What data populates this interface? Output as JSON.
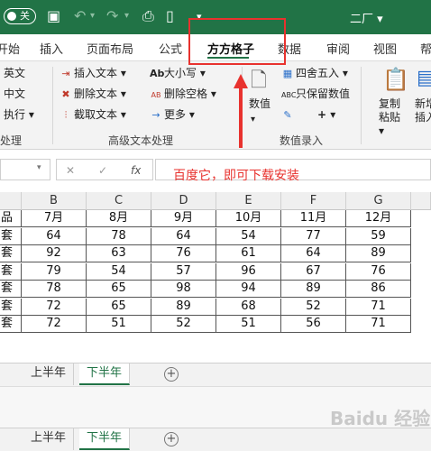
{
  "titlebar": {
    "autosave_label": "关",
    "doc_title": "二厂 ▾",
    "accent": "#217346"
  },
  "tabs": [
    "开始",
    "插入",
    "页面布局",
    "公式",
    "方方格子",
    "数据",
    "审阅",
    "视图",
    "帮"
  ],
  "active_tab": "方方格子",
  "ribbon": {
    "col1": [
      "英文",
      "中文",
      "执行 ▾"
    ],
    "group1_label": "处理",
    "col2": [
      "插入文本 ▾",
      "删除文本 ▾",
      "截取文本 ▾"
    ],
    "col3": [
      "大小写 ▾",
      "删除空格 ▾",
      "更多 ▾"
    ],
    "col3_icons": [
      "Ab",
      "AB",
      "→"
    ],
    "group2_label": "高级文本处理",
    "numeric_label": "数值",
    "round_label": "四舍五入 ▾",
    "keep_numeric_label": "只保留数值",
    "plus_label": "+ ▾",
    "group3_label": "数值录入",
    "copy_paste_label": "复制粘贴 ▾",
    "new_label": "新增插入"
  },
  "formula_bar": {
    "cancel": "✕",
    "enter": "✓",
    "fx": "fx"
  },
  "annotation": {
    "text": "百度它，即可下载安装",
    "color": "#e8322e"
  },
  "grid": {
    "columns": [
      "B",
      "C",
      "D",
      "E",
      "F",
      "G"
    ],
    "months": [
      "7月",
      "8月",
      "9月",
      "10月",
      "11月",
      "12月"
    ],
    "row_labels": [
      "品",
      "套",
      "套",
      "套",
      "套",
      "套",
      "套"
    ],
    "rows": [
      [
        64,
        78,
        64,
        54,
        77,
        59
      ],
      [
        92,
        63,
        76,
        61,
        64,
        89
      ],
      [
        79,
        54,
        57,
        96,
        67,
        76
      ],
      [
        78,
        65,
        98,
        94,
        89,
        86
      ],
      [
        72,
        65,
        89,
        68,
        52,
        71
      ],
      [
        72,
        51,
        52,
        51,
        56,
        71
      ]
    ]
  },
  "sheets": [
    "上半年",
    "下半年"
  ],
  "active_sheet": "下半年",
  "add_sheet": "+",
  "watermark": "Baidu 经验"
}
